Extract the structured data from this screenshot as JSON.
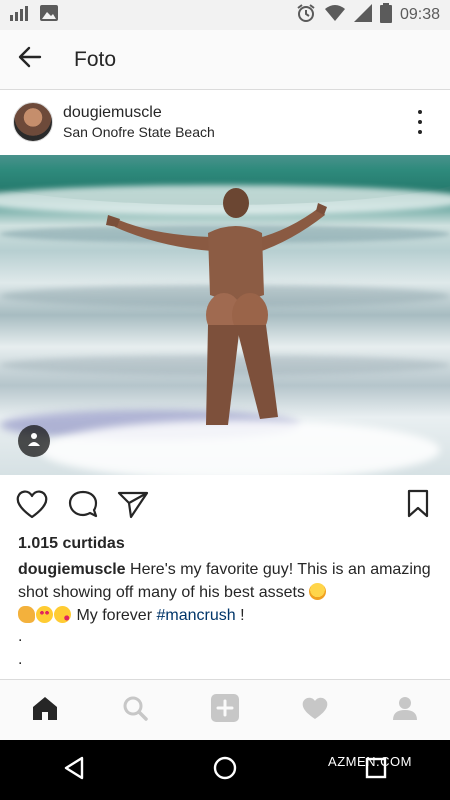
{
  "status_bar": {
    "time": "09:38"
  },
  "app_bar": {
    "title": "Foto"
  },
  "post": {
    "username": "dougiemuscle",
    "location": "San Onofre State Beach",
    "likes": "1.015 curtidas",
    "caption": {
      "username": "dougiemuscle",
      "text_1": " Here's my favorite guy! This is an amazing shot showing off many of his best assets ",
      "text_2": " My forever ",
      "hashtag": "#mancrush",
      "text_3": " !",
      "emojis": [
        "hugging-face",
        "flexed-biceps",
        "heart-eyes",
        "kissing-heart"
      ]
    },
    "extra_lines": [
      ".",
      "."
    ]
  },
  "bottom_nav": [
    "home-icon",
    "search-icon",
    "add-icon",
    "heart-icon",
    "profile-icon"
  ],
  "watermark": "AZMEN.COM",
  "colors": {
    "hashtag": "#003569",
    "text": "#262626",
    "nav_bg": "#fafafa"
  }
}
